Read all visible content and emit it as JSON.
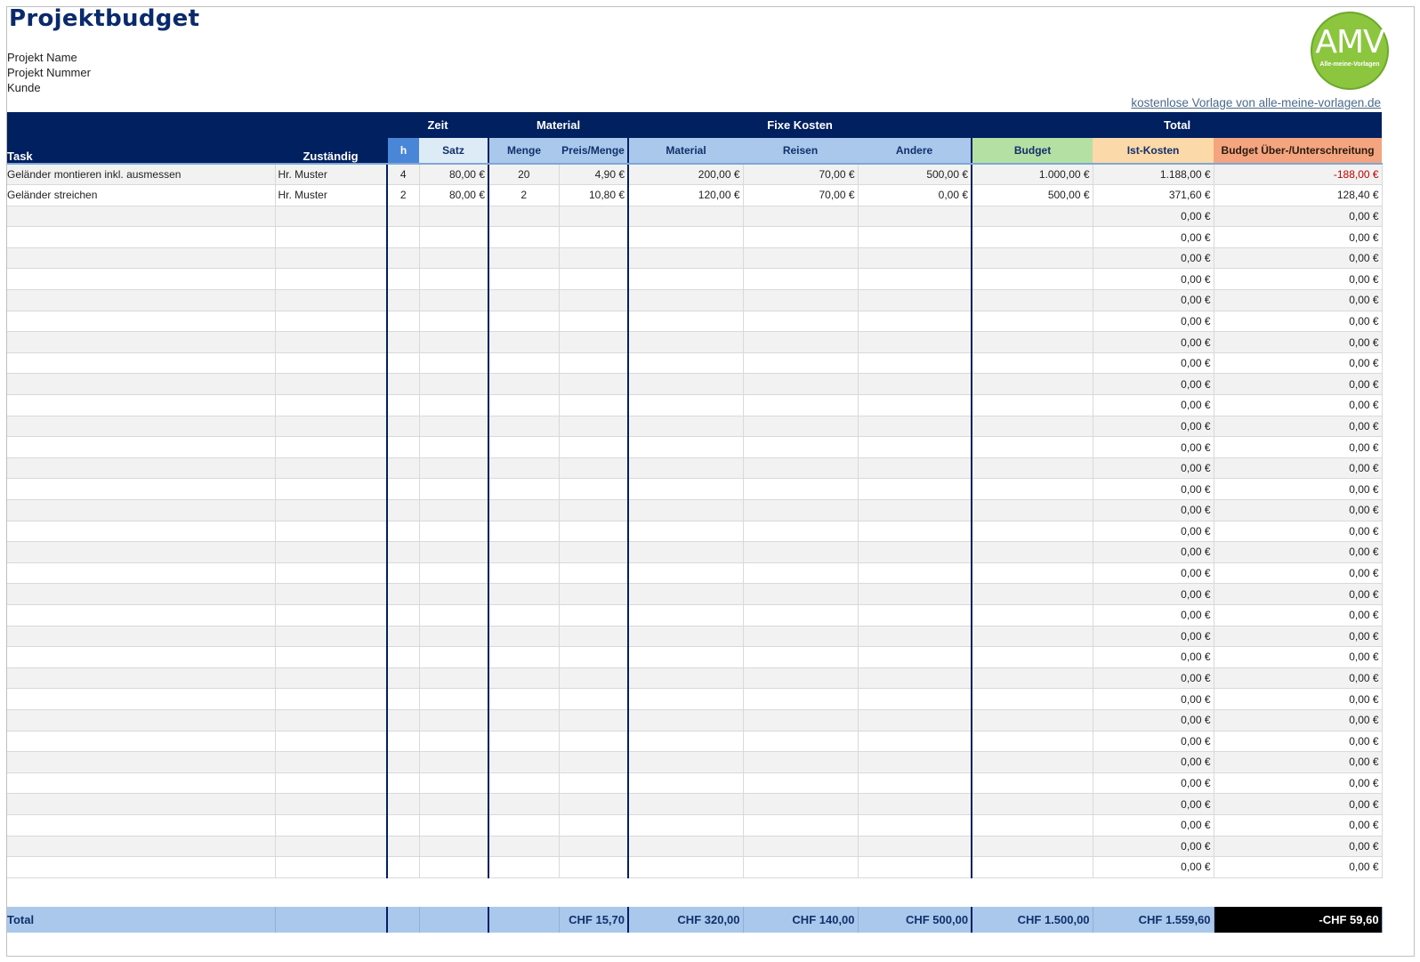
{
  "header": {
    "title": "Projektbudget",
    "project_name_label": "Projekt Name",
    "project_number_label": "Projekt Nummer",
    "customer_label": "Kunde",
    "credit_link": "kostenlose Vorlage von alle-meine-vorlagen.de",
    "logo_main": "AMV",
    "logo_sub": "Alle-meine-Vorlagen"
  },
  "groups": {
    "zeit": "Zeit",
    "material": "Material",
    "fixe": "Fixe Kosten",
    "total": "Total"
  },
  "columns": {
    "task": "Task",
    "zustaendig": "Zuständig",
    "h": "h",
    "satz": "Satz",
    "menge": "Menge",
    "preis": "Preis/Menge",
    "fk_material": "Material",
    "reisen": "Reisen",
    "andere": "Andere",
    "budget": "Budget",
    "ist": "Ist-Kosten",
    "diff": "Budget Über-/Unterschreitung"
  },
  "colors": {
    "navy": "#002060",
    "header_blue": "#a9c8ec",
    "budget_green": "#b5e0a3",
    "ist_peach": "#fbd9a8",
    "diff_orange": "#f4a57f",
    "negative_red": "#c00000"
  },
  "rows": [
    {
      "task": "Geländer montieren inkl. ausmessen",
      "zustaendig": "Hr. Muster",
      "h": "4",
      "satz": "80,00 €",
      "menge": "20",
      "preis": "4,90 €",
      "fk_material": "200,00 €",
      "reisen": "70,00 €",
      "andere": "500,00 €",
      "budget": "1.000,00 €",
      "ist": "1.188,00 €",
      "diff": "-188,00 €",
      "neg": true
    },
    {
      "task": "Geländer streichen",
      "zustaendig": "Hr. Muster",
      "h": "2",
      "satz": "80,00 €",
      "menge": "2",
      "preis": "10,80 €",
      "fk_material": "120,00 €",
      "reisen": "70,00 €",
      "andere": "0,00 €",
      "budget": "500,00 €",
      "ist": "371,60 €",
      "diff": "128,40 €",
      "neg": false
    }
  ],
  "empty_row_values": {
    "ist": "0,00 €",
    "diff": "0,00 €"
  },
  "empty_row_count": 32,
  "footer": {
    "label": "Total",
    "preis": "CHF 15,70",
    "fk_material": "CHF 320,00",
    "reisen": "CHF 140,00",
    "andere": "CHF 500,00",
    "budget": "CHF 1.500,00",
    "ist": "CHF 1.559,60",
    "diff": "-CHF 59,60"
  }
}
